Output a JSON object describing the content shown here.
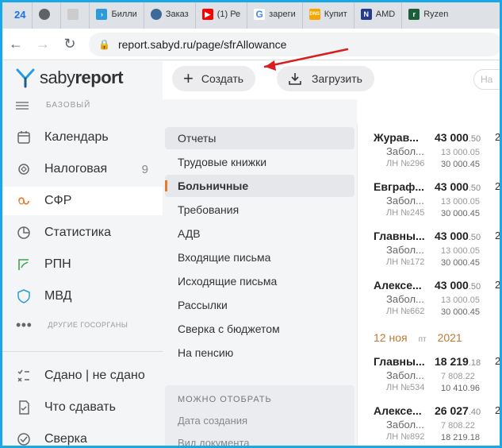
{
  "browser": {
    "tabs": [
      {
        "label": "24",
        "color": "#1a73e8"
      },
      {
        "label": "",
        "color": "#5f6368"
      },
      {
        "label": "",
        "color": "#999999"
      },
      {
        "label": "Билли",
        "color": "#2c9bdb"
      },
      {
        "label": "Заказ",
        "color": "#3d6a99"
      },
      {
        "label": "(1) Ре",
        "color": "#ff0000"
      },
      {
        "label": "зареги",
        "color": "#4285f4"
      },
      {
        "label": "Купит",
        "color": "#f7a600"
      },
      {
        "label": "AMD",
        "color": "#233b8a"
      },
      {
        "label": "Ryzen",
        "color": "#1d5e3a"
      }
    ],
    "url": "report.sabyd.ru/page/sfrAllowance"
  },
  "logo": {
    "part1": "saby",
    "part2": "report"
  },
  "plan_label": "БАЗОВЫЙ",
  "nav": [
    {
      "label": "Календарь",
      "icon": "calendar-icon"
    },
    {
      "label": "Налоговая",
      "icon": "tax-icon",
      "count": "9"
    },
    {
      "label": "СФР",
      "icon": "sfr-icon",
      "active": true
    },
    {
      "label": "Статистика",
      "icon": "pie-chart-icon"
    },
    {
      "label": "РПН",
      "icon": "rpn-icon"
    },
    {
      "label": "МВД",
      "icon": "shield-icon"
    }
  ],
  "more_label": "ДРУГИЕ ГОСОРГАНЫ",
  "nav_bottom": [
    {
      "label": "Сдано | не сдано",
      "icon": "checklist-icon"
    },
    {
      "label": "Что сдавать",
      "icon": "document-check-icon"
    },
    {
      "label": "Сверка",
      "icon": "reconcile-icon"
    }
  ],
  "toolbar": {
    "create_label": "Создать",
    "upload_label": "Загрузить",
    "search_placeholder": "На"
  },
  "categories": [
    "Отчеты",
    "Трудовые книжки",
    "Больничные",
    "Требования",
    "АДВ",
    "Входящие письма",
    "Исходящие письма",
    "Рассылки",
    "Сверка с бюджетом",
    "На пенсию"
  ],
  "filter": {
    "title": "МОЖНО ОТОБРАТЬ",
    "items": [
      "Дата создания",
      "Вид документа"
    ]
  },
  "records": [
    {
      "name": "Журав...",
      "sum_main": "43 000",
      "sum_cents": ".50",
      "sub": "Забол...",
      "ln": "ЛН №296",
      "v1": "13 000.05",
      "v2": "30 000.45",
      "edge": "2"
    },
    {
      "name": "Евграф...",
      "sum_main": "43 000",
      "sum_cents": ".50",
      "sub": "Забол...",
      "ln": "ЛН №245",
      "v1": "13 000.05",
      "v2": "30 000.45",
      "edge": "2"
    },
    {
      "name": "Главны...",
      "sum_main": "43 000",
      "sum_cents": ".50",
      "sub": "Забол...",
      "ln": "ЛН №172",
      "v1": "13 000.05",
      "v2": "30 000.45",
      "edge": "2"
    },
    {
      "name": "Алексе...",
      "sum_main": "43 000",
      "sum_cents": ".50",
      "sub": "Забол...",
      "ln": "ЛН №662",
      "v1": "13 000.05",
      "v2": "30 000.45",
      "edge": "2"
    }
  ],
  "date_group": {
    "date": "12 ноя",
    "weekday": "пт",
    "year": "2021"
  },
  "records2": [
    {
      "name": "Главны...",
      "sum_main": "18 219",
      "sum_cents": ".18",
      "sub": "Забол...",
      "ln": "ЛН №534",
      "v1": "7 808.22",
      "v2": "10 410.96",
      "edge": "2"
    },
    {
      "name": "Алексе...",
      "sum_main": "26 027",
      "sum_cents": ".40",
      "sub": "Забол...",
      "ln": "ЛН №892",
      "v1": "7 808.22",
      "v2": "18 219.18",
      "edge": "2"
    }
  ]
}
